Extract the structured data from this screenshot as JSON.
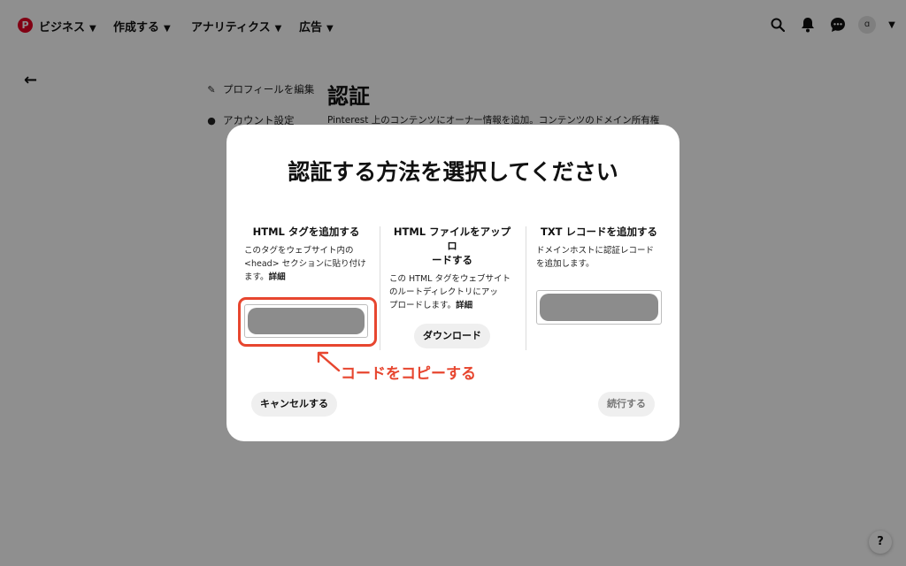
{
  "nav": {
    "items": [
      {
        "label": "ビジネス"
      },
      {
        "label": "作成する"
      },
      {
        "label": "アナリティクス"
      },
      {
        "label": "広告"
      }
    ],
    "avatar_initial": "ɑ"
  },
  "sidebar": {
    "items": [
      {
        "label": "プロフィールを編集"
      },
      {
        "label": "アカウント設定"
      }
    ]
  },
  "main": {
    "title": "認証",
    "description": "Pinterest 上のコンテンツにオーナー情報を追加。コンテンツのドメイン所有権"
  },
  "modal": {
    "title": "認証する方法を選択してください",
    "columns": [
      {
        "title": "HTML タグを追加する",
        "desc_lines": [
          "このタグをウェブサイト内の",
          "<head> セクションに貼り付け",
          "ます。"
        ],
        "link": "詳細"
      },
      {
        "title_lines": [
          "HTML ファイルをアップロ",
          "ードする"
        ],
        "desc_lines": [
          "この HTML タグをウェブサイト",
          "のルートディレクトリにアッ",
          "プロードします。"
        ],
        "link": "詳細",
        "button": "ダウンロード"
      },
      {
        "title": "TXT レコードを追加する",
        "desc_lines": [
          "ドメインホストに認証レコード",
          "を追加します。"
        ]
      }
    ],
    "cancel_label": "キャンセルする",
    "continue_label": "続行する"
  },
  "annotation": {
    "label": "コードをコピーする",
    "color": "#e7462f"
  },
  "help_label": "?"
}
